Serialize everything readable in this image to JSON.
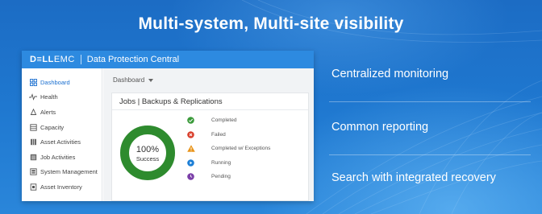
{
  "slide": {
    "title": "Multi-system, Multi-site visibility",
    "features": [
      "Centralized monitoring",
      "Common reporting",
      "Search with integrated recovery"
    ]
  },
  "app": {
    "brand_bold": "D≡LL",
    "brand_thin": "EMC",
    "name": "Data Protection Central",
    "accent_color": "#2d8ae0"
  },
  "sidebar": {
    "items": [
      {
        "label": "Dashboard",
        "icon": "dashboard-icon",
        "active": true
      },
      {
        "label": "Health",
        "icon": "pulse-icon",
        "active": false
      },
      {
        "label": "Alerts",
        "icon": "bell-icon",
        "active": false
      },
      {
        "label": "Capacity",
        "icon": "database-icon",
        "active": false
      },
      {
        "label": "Asset Activities",
        "icon": "server-icon",
        "active": false
      },
      {
        "label": "Job Activities",
        "icon": "jobs-icon",
        "active": false
      },
      {
        "label": "System Management",
        "icon": "system-icon",
        "active": false
      },
      {
        "label": "Asset Inventory",
        "icon": "inventory-icon",
        "active": false
      }
    ]
  },
  "main": {
    "dashboard_select": "Dashboard",
    "card_title": "Jobs | Backups & Replications",
    "donut": {
      "percent_label": "100%",
      "status_label": "Success",
      "value": 1.0,
      "color": "#2e8b2e"
    },
    "legend": [
      {
        "label": "Completed",
        "icon": "check-circle-icon",
        "color": "#3a9a3a"
      },
      {
        "label": "Failed",
        "icon": "x-circle-icon",
        "color": "#d9412e"
      },
      {
        "label": "Completed w/ Exceptions",
        "icon": "warning-triangle-icon",
        "color": "#e8941a"
      },
      {
        "label": "Running",
        "icon": "play-circle-icon",
        "color": "#1d7fd6"
      },
      {
        "label": "Pending",
        "icon": "clock-circle-icon",
        "color": "#7b3fa8"
      }
    ]
  }
}
